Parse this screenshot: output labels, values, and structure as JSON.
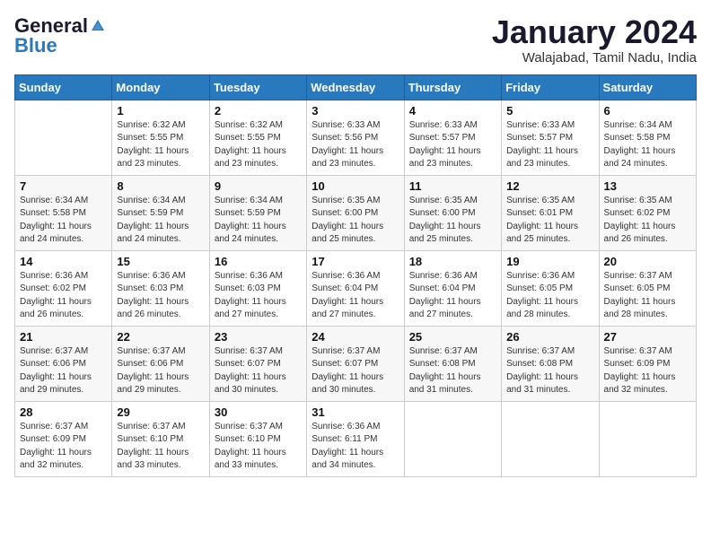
{
  "header": {
    "logo_line1": "General",
    "logo_line2": "Blue",
    "month": "January 2024",
    "location": "Walajabad, Tamil Nadu, India"
  },
  "days_of_week": [
    "Sunday",
    "Monday",
    "Tuesday",
    "Wednesday",
    "Thursday",
    "Friday",
    "Saturday"
  ],
  "weeks": [
    [
      {
        "day": "",
        "info": ""
      },
      {
        "day": "1",
        "info": "Sunrise: 6:32 AM\nSunset: 5:55 PM\nDaylight: 11 hours\nand 23 minutes."
      },
      {
        "day": "2",
        "info": "Sunrise: 6:32 AM\nSunset: 5:55 PM\nDaylight: 11 hours\nand 23 minutes."
      },
      {
        "day": "3",
        "info": "Sunrise: 6:33 AM\nSunset: 5:56 PM\nDaylight: 11 hours\nand 23 minutes."
      },
      {
        "day": "4",
        "info": "Sunrise: 6:33 AM\nSunset: 5:57 PM\nDaylight: 11 hours\nand 23 minutes."
      },
      {
        "day": "5",
        "info": "Sunrise: 6:33 AM\nSunset: 5:57 PM\nDaylight: 11 hours\nand 23 minutes."
      },
      {
        "day": "6",
        "info": "Sunrise: 6:34 AM\nSunset: 5:58 PM\nDaylight: 11 hours\nand 24 minutes."
      }
    ],
    [
      {
        "day": "7",
        "info": "Sunrise: 6:34 AM\nSunset: 5:58 PM\nDaylight: 11 hours\nand 24 minutes."
      },
      {
        "day": "8",
        "info": "Sunrise: 6:34 AM\nSunset: 5:59 PM\nDaylight: 11 hours\nand 24 minutes."
      },
      {
        "day": "9",
        "info": "Sunrise: 6:34 AM\nSunset: 5:59 PM\nDaylight: 11 hours\nand 24 minutes."
      },
      {
        "day": "10",
        "info": "Sunrise: 6:35 AM\nSunset: 6:00 PM\nDaylight: 11 hours\nand 25 minutes."
      },
      {
        "day": "11",
        "info": "Sunrise: 6:35 AM\nSunset: 6:00 PM\nDaylight: 11 hours\nand 25 minutes."
      },
      {
        "day": "12",
        "info": "Sunrise: 6:35 AM\nSunset: 6:01 PM\nDaylight: 11 hours\nand 25 minutes."
      },
      {
        "day": "13",
        "info": "Sunrise: 6:35 AM\nSunset: 6:02 PM\nDaylight: 11 hours\nand 26 minutes."
      }
    ],
    [
      {
        "day": "14",
        "info": "Sunrise: 6:36 AM\nSunset: 6:02 PM\nDaylight: 11 hours\nand 26 minutes."
      },
      {
        "day": "15",
        "info": "Sunrise: 6:36 AM\nSunset: 6:03 PM\nDaylight: 11 hours\nand 26 minutes."
      },
      {
        "day": "16",
        "info": "Sunrise: 6:36 AM\nSunset: 6:03 PM\nDaylight: 11 hours\nand 27 minutes."
      },
      {
        "day": "17",
        "info": "Sunrise: 6:36 AM\nSunset: 6:04 PM\nDaylight: 11 hours\nand 27 minutes."
      },
      {
        "day": "18",
        "info": "Sunrise: 6:36 AM\nSunset: 6:04 PM\nDaylight: 11 hours\nand 27 minutes."
      },
      {
        "day": "19",
        "info": "Sunrise: 6:36 AM\nSunset: 6:05 PM\nDaylight: 11 hours\nand 28 minutes."
      },
      {
        "day": "20",
        "info": "Sunrise: 6:37 AM\nSunset: 6:05 PM\nDaylight: 11 hours\nand 28 minutes."
      }
    ],
    [
      {
        "day": "21",
        "info": "Sunrise: 6:37 AM\nSunset: 6:06 PM\nDaylight: 11 hours\nand 29 minutes."
      },
      {
        "day": "22",
        "info": "Sunrise: 6:37 AM\nSunset: 6:06 PM\nDaylight: 11 hours\nand 29 minutes."
      },
      {
        "day": "23",
        "info": "Sunrise: 6:37 AM\nSunset: 6:07 PM\nDaylight: 11 hours\nand 30 minutes."
      },
      {
        "day": "24",
        "info": "Sunrise: 6:37 AM\nSunset: 6:07 PM\nDaylight: 11 hours\nand 30 minutes."
      },
      {
        "day": "25",
        "info": "Sunrise: 6:37 AM\nSunset: 6:08 PM\nDaylight: 11 hours\nand 31 minutes."
      },
      {
        "day": "26",
        "info": "Sunrise: 6:37 AM\nSunset: 6:08 PM\nDaylight: 11 hours\nand 31 minutes."
      },
      {
        "day": "27",
        "info": "Sunrise: 6:37 AM\nSunset: 6:09 PM\nDaylight: 11 hours\nand 32 minutes."
      }
    ],
    [
      {
        "day": "28",
        "info": "Sunrise: 6:37 AM\nSunset: 6:09 PM\nDaylight: 11 hours\nand 32 minutes."
      },
      {
        "day": "29",
        "info": "Sunrise: 6:37 AM\nSunset: 6:10 PM\nDaylight: 11 hours\nand 33 minutes."
      },
      {
        "day": "30",
        "info": "Sunrise: 6:37 AM\nSunset: 6:10 PM\nDaylight: 11 hours\nand 33 minutes."
      },
      {
        "day": "31",
        "info": "Sunrise: 6:36 AM\nSunset: 6:11 PM\nDaylight: 11 hours\nand 34 minutes."
      },
      {
        "day": "",
        "info": ""
      },
      {
        "day": "",
        "info": ""
      },
      {
        "day": "",
        "info": ""
      }
    ]
  ]
}
